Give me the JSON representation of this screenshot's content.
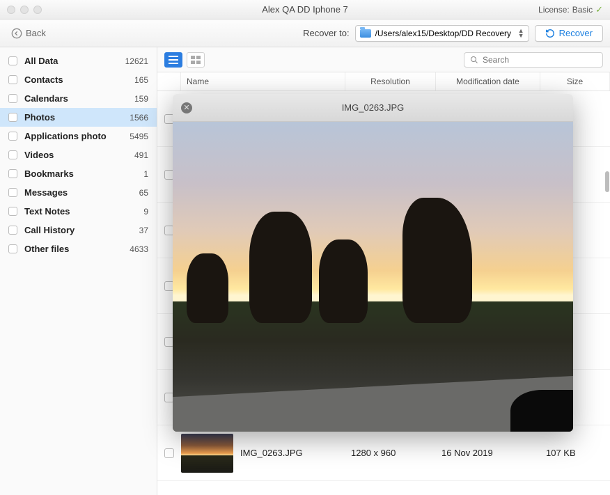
{
  "window": {
    "title": "Alex QA DD Iphone 7",
    "license_label": "License:",
    "license_value": "Basic"
  },
  "toolbar": {
    "back_label": "Back",
    "recover_to_label": "Recover to:",
    "recover_path": "/Users/alex15/Desktop/DD Recovery",
    "recover_button": "Recover"
  },
  "sidebar": {
    "items": [
      {
        "label": "All Data",
        "count": "12621"
      },
      {
        "label": "Contacts",
        "count": "165"
      },
      {
        "label": "Calendars",
        "count": "159"
      },
      {
        "label": "Photos",
        "count": "1566"
      },
      {
        "label": "Applications photo",
        "count": "5495"
      },
      {
        "label": "Videos",
        "count": "491"
      },
      {
        "label": "Bookmarks",
        "count": "1"
      },
      {
        "label": "Messages",
        "count": "65"
      },
      {
        "label": "Text Notes",
        "count": "9"
      },
      {
        "label": "Call History",
        "count": "37"
      },
      {
        "label": "Other files",
        "count": "4633"
      }
    ],
    "selected_index": 3
  },
  "main_toolbar": {
    "search_placeholder": "Search"
  },
  "columns": {
    "name": "Name",
    "resolution": "Resolution",
    "date": "Modification date",
    "size": "Size"
  },
  "rows": [
    {
      "name": "IMG_0263.JPG",
      "resolution": "1280 x 960",
      "date": "16 Nov 2019",
      "size": "107 KB"
    }
  ],
  "preview": {
    "title": "IMG_0263.JPG"
  }
}
